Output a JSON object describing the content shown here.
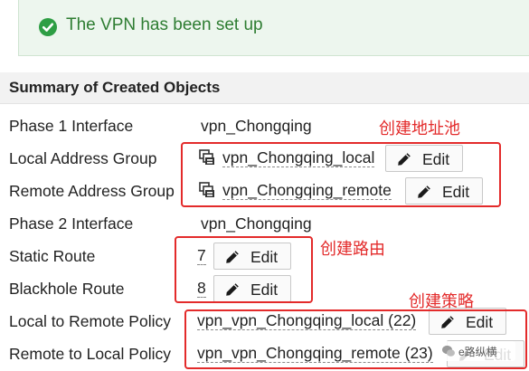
{
  "banner": {
    "message": "The VPN has been set up",
    "color": "#2e7d32"
  },
  "summary": {
    "title": "Summary of Created Objects",
    "rows": [
      {
        "label": "Phase 1 Interface",
        "value": "vpn_Chongqing"
      },
      {
        "label": "Local Address Group",
        "value": "vpn_Chongqing_local",
        "action": "Edit"
      },
      {
        "label": "Remote Address Group",
        "value": "vpn_Chongqing_remote",
        "action": "Edit"
      },
      {
        "label": "Phase 2 Interface",
        "value": "vpn_Chongqing"
      },
      {
        "label": "Static Route",
        "value": "7",
        "action": "Edit"
      },
      {
        "label": "Blackhole Route",
        "value": "8",
        "action": "Edit"
      },
      {
        "label": "Local to Remote Policy",
        "value": "vpn_vpn_Chongqing_local (22)",
        "action": "Edit"
      },
      {
        "label": "Remote to Local Policy",
        "value": "vpn_vpn_Chongqing_remote (23)",
        "action": "Edit"
      }
    ]
  },
  "annotations": {
    "address_pool": "创建地址池",
    "route": "创建路由",
    "policy": "创建策略",
    "color": "#e32b2b"
  },
  "watermark": {
    "text": "e路纵横"
  }
}
